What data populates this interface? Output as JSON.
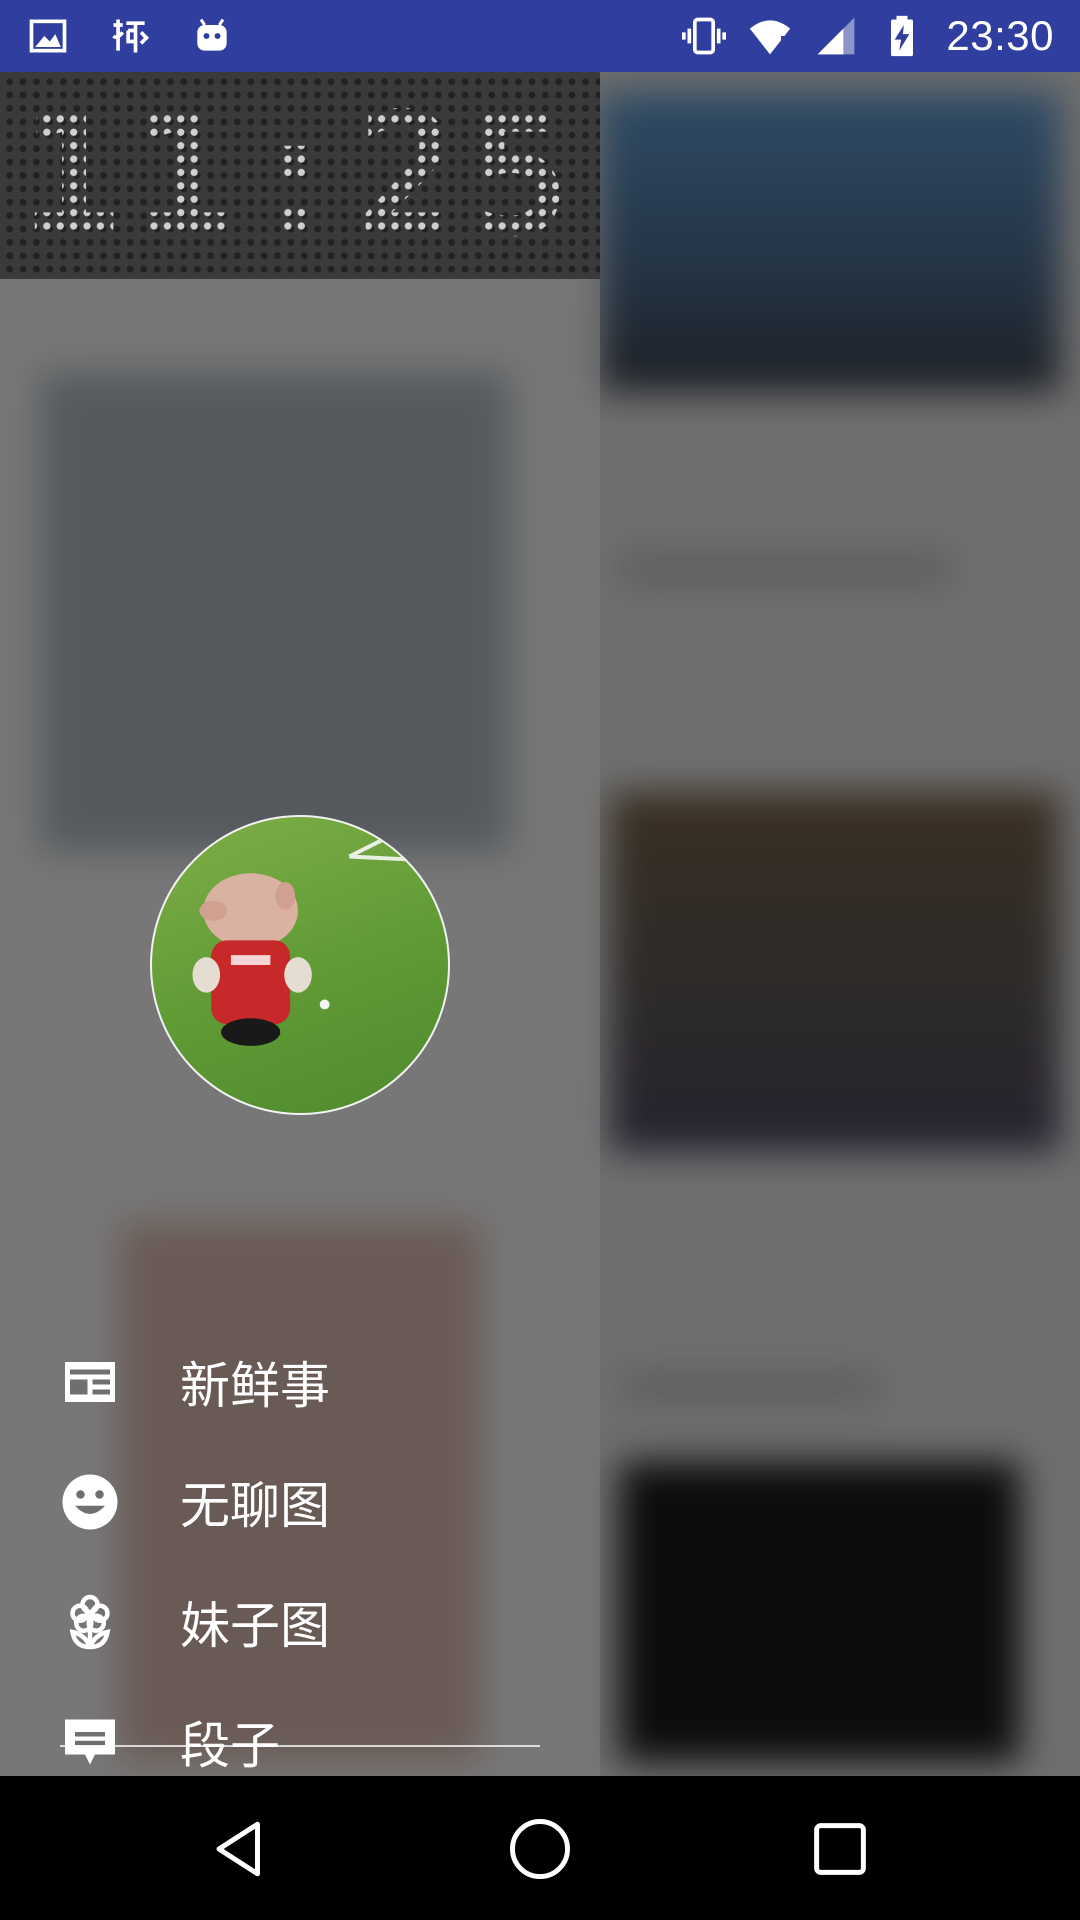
{
  "status_bar": {
    "time": "23:30",
    "left_icons": [
      "image-icon",
      "xia-app-icon",
      "android-icon"
    ],
    "right_icons": [
      "vibrate-icon",
      "wifi-icon",
      "signal-icon",
      "battery-charging-icon"
    ],
    "background_color": "#303f9f"
  },
  "drawer": {
    "clock": "11:25",
    "menu": [
      {
        "label": "新鲜事",
        "icon": "newspaper-icon"
      },
      {
        "label": "无聊图",
        "icon": "smiley-icon"
      },
      {
        "label": "妹子图",
        "icon": "flower-icon"
      },
      {
        "label": "段子",
        "icon": "chat-icon"
      }
    ]
  },
  "nav_bar": {
    "buttons": [
      "back-icon",
      "home-icon",
      "recents-icon"
    ]
  }
}
